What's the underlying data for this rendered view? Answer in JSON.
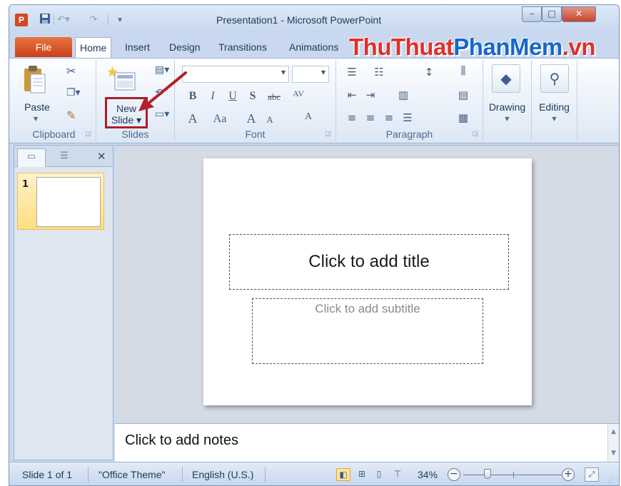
{
  "window": {
    "title": "Presentation1  -  Microsoft PowerPoint",
    "app_icon": "P",
    "controls": {
      "minimize": "–",
      "maximize": "□",
      "close": "✕"
    }
  },
  "quick_access": {
    "save_icon": "save-icon",
    "undo_icon": "undo-icon",
    "redo_icon": "redo-icon",
    "customize_icon": "customize-qat-icon"
  },
  "tabs": {
    "file": "File",
    "home": "Home",
    "insert": "Insert",
    "design": "Design",
    "transitions": "Transitions",
    "animations": "Animations"
  },
  "watermark": {
    "part1": "ThuThuat",
    "part2": "PhanMem",
    "part3": ".vn"
  },
  "ribbon": {
    "clipboard": {
      "label": "Clipboard",
      "paste": "Paste"
    },
    "slides": {
      "label": "Slides",
      "new_slide_line1": "New",
      "new_slide_line2": "Slide ▾"
    },
    "font": {
      "label": "Font",
      "bold": "B",
      "italic": "I",
      "underline": "U",
      "shadow": "S",
      "strike": "abc",
      "spacing": "AV",
      "color": "A",
      "case": "Aa",
      "grow": "A",
      "shrink": "A",
      "clear": "A"
    },
    "paragraph": {
      "label": "Paragraph"
    },
    "drawing": {
      "label": "Drawing"
    },
    "editing": {
      "label": "Editing"
    }
  },
  "left_panel": {
    "close": "✕",
    "slide_number": "1"
  },
  "slide": {
    "title_placeholder": "Click to add title",
    "subtitle_placeholder": "Click to add subtitle"
  },
  "notes": {
    "placeholder": "Click to add notes"
  },
  "status_bar": {
    "slide_info": "Slide 1 of 1",
    "theme": "\"Office Theme\"",
    "language": "English (U.S.)",
    "zoom": "34%",
    "zoom_fraction": 0.24
  },
  "colors": {
    "file_tab": "#d24726",
    "highlight_box": "#a91f2a",
    "watermark_red": "#e0302c",
    "watermark_blue": "#1767c8"
  }
}
